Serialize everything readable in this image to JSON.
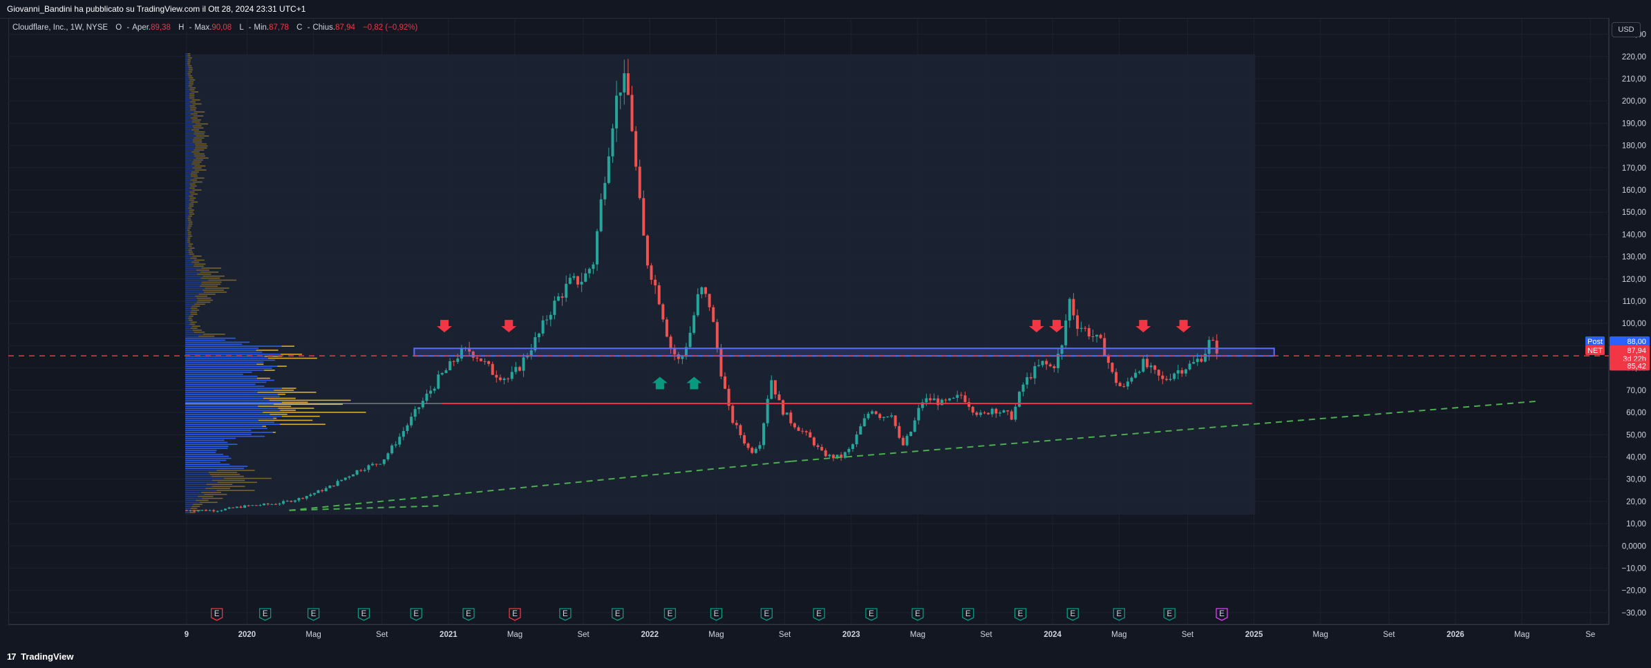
{
  "header": {
    "publish_line": "Giovanni_Bandini ha pubblicato su TradingView.com il Ott 28, 2024 23:31 UTC+1"
  },
  "legend": {
    "symbol": "Cloudflare, Inc., 1W, NYSE",
    "open_label": "O",
    "open_prefix": "Aper.",
    "open": "89,38",
    "high_label": "H",
    "high_prefix": "Max.",
    "high": "90,08",
    "low_label": "L",
    "low_prefix": "Min.",
    "low": "87,78",
    "close_label": "C",
    "close_prefix": "Chius.",
    "close": "87,94",
    "change": "−0,82 (−0,92%)"
  },
  "price_axis": {
    "currency_button": "USD",
    "post_tag": "Post",
    "post_value": "88,00",
    "symbol_tag": "NET",
    "last_value": "87,94",
    "countdown": "3d 22h",
    "line_value": "85,42"
  },
  "footer": {
    "brand": "TradingView",
    "brand_mark": "17"
  },
  "colors": {
    "background": "#131722",
    "up": "#26a69a",
    "down": "#ef5350",
    "resistance_box": "#5b6cff",
    "support_line": "#f23645",
    "trend_line": "#4caf50",
    "vp_blue": "#2962ff",
    "vp_yellow": "#e8b430",
    "arrow_down": "#f23645",
    "arrow_up": "#089981"
  },
  "chart_data": {
    "type": "candlestick",
    "price_ticks": [
      "230,00",
      "220,00",
      "210,00",
      "200,00",
      "190,00",
      "180,00",
      "170,00",
      "160,00",
      "150,00",
      "140,00",
      "130,00",
      "120,00",
      "110,00",
      "100,00",
      "90,00",
      "80,00",
      "70,00",
      "60,00",
      "50,00",
      "40,00",
      "30,00",
      "20,00",
      "10,00",
      "0,0000",
      "−10,00",
      "−20,00",
      "−30,00"
    ],
    "price_tick_values": [
      230,
      220,
      210,
      200,
      190,
      180,
      170,
      160,
      150,
      140,
      130,
      120,
      110,
      100,
      90,
      80,
      70,
      60,
      50,
      40,
      30,
      20,
      10,
      0,
      -10,
      -20,
      -30
    ],
    "ylim": [
      -35,
      237
    ],
    "time_ticks": [
      {
        "label": "9",
        "t": 2019.7
      },
      {
        "label": "2020",
        "t": 2020.0
      },
      {
        "label": "Mag",
        "t": 2020.33
      },
      {
        "label": "Set",
        "t": 2020.67
      },
      {
        "label": "2021",
        "t": 2021.0
      },
      {
        "label": "Mag",
        "t": 2021.33
      },
      {
        "label": "Set",
        "t": 2021.67
      },
      {
        "label": "2022",
        "t": 2022.0
      },
      {
        "label": "Mag",
        "t": 2022.33
      },
      {
        "label": "Set",
        "t": 2022.67
      },
      {
        "label": "2023",
        "t": 2023.0
      },
      {
        "label": "Mag",
        "t": 2023.33
      },
      {
        "label": "Set",
        "t": 2023.67
      },
      {
        "label": "2024",
        "t": 2024.0
      },
      {
        "label": "Mag",
        "t": 2024.33
      },
      {
        "label": "Set",
        "t": 2024.67
      },
      {
        "label": "2025",
        "t": 2025.0
      },
      {
        "label": "Mag",
        "t": 2025.33
      },
      {
        "label": "Set",
        "t": 2025.67
      },
      {
        "label": "2026",
        "t": 2026.0
      },
      {
        "label": "Mag",
        "t": 2026.33
      },
      {
        "label": "Se",
        "t": 2026.67
      }
    ],
    "xlim": [
      2019.7,
      2026.7
    ],
    "price_path": [
      [
        2019.7,
        16
      ],
      [
        2019.85,
        16
      ],
      [
        2020.0,
        18
      ],
      [
        2020.15,
        19
      ],
      [
        2020.25,
        21
      ],
      [
        2020.4,
        26
      ],
      [
        2020.55,
        34
      ],
      [
        2020.67,
        38
      ],
      [
        2020.75,
        48
      ],
      [
        2020.85,
        62
      ],
      [
        2020.95,
        75
      ],
      [
        2021.0,
        80
      ],
      [
        2021.05,
        86
      ],
      [
        2021.1,
        88
      ],
      [
        2021.15,
        85
      ],
      [
        2021.22,
        78
      ],
      [
        2021.3,
        75
      ],
      [
        2021.35,
        80
      ],
      [
        2021.4,
        88
      ],
      [
        2021.45,
        95
      ],
      [
        2021.5,
        105
      ],
      [
        2021.55,
        112
      ],
      [
        2021.6,
        118
      ],
      [
        2021.67,
        120
      ],
      [
        2021.72,
        128
      ],
      [
        2021.78,
        170
      ],
      [
        2021.82,
        195
      ],
      [
        2021.86,
        210
      ],
      [
        2021.9,
        200
      ],
      [
        2021.94,
        160
      ],
      [
        2021.98,
        130
      ],
      [
        2022.0,
        125
      ],
      [
        2022.05,
        110
      ],
      [
        2022.1,
        90
      ],
      [
        2022.15,
        82
      ],
      [
        2022.2,
        96
      ],
      [
        2022.25,
        116
      ],
      [
        2022.3,
        108
      ],
      [
        2022.35,
        80
      ],
      [
        2022.4,
        58
      ],
      [
        2022.45,
        50
      ],
      [
        2022.5,
        42
      ],
      [
        2022.55,
        47
      ],
      [
        2022.6,
        76
      ],
      [
        2022.65,
        62
      ],
      [
        2022.7,
        56
      ],
      [
        2022.75,
        52
      ],
      [
        2022.8,
        48
      ],
      [
        2022.85,
        42
      ],
      [
        2022.9,
        40
      ],
      [
        2022.95,
        40
      ],
      [
        2023.0,
        44
      ],
      [
        2023.05,
        54
      ],
      [
        2023.1,
        62
      ],
      [
        2023.15,
        58
      ],
      [
        2023.2,
        60
      ],
      [
        2023.25,
        44
      ],
      [
        2023.3,
        52
      ],
      [
        2023.35,
        65
      ],
      [
        2023.4,
        66
      ],
      [
        2023.45,
        64
      ],
      [
        2023.5,
        65
      ],
      [
        2023.55,
        68
      ],
      [
        2023.6,
        62
      ],
      [
        2023.65,
        58
      ],
      [
        2023.7,
        62
      ],
      [
        2023.75,
        60
      ],
      [
        2023.8,
        58
      ],
      [
        2023.85,
        72
      ],
      [
        2023.9,
        78
      ],
      [
        2023.95,
        82
      ],
      [
        2024.0,
        80
      ],
      [
        2024.05,
        90
      ],
      [
        2024.08,
        112
      ],
      [
        2024.12,
        100
      ],
      [
        2024.18,
        96
      ],
      [
        2024.25,
        90
      ],
      [
        2024.3,
        76
      ],
      [
        2024.35,
        70
      ],
      [
        2024.4,
        78
      ],
      [
        2024.45,
        82
      ],
      [
        2024.5,
        78
      ],
      [
        2024.55,
        74
      ],
      [
        2024.6,
        78
      ],
      [
        2024.65,
        80
      ],
      [
        2024.7,
        82
      ],
      [
        2024.75,
        86
      ],
      [
        2024.78,
        92
      ],
      [
        2024.82,
        88
      ]
    ],
    "volume_profile_poc": 64,
    "resistance_zone": {
      "low": 85.4,
      "high": 88.8,
      "t_start": 2020.83,
      "t_end": 2025.1
    },
    "support_line": {
      "value": 64,
      "t_start": 2020.97,
      "t_end": 2024.99
    },
    "last_price_line": 85.42,
    "trend_lines": [
      {
        "t1": 2020.21,
        "p1": 16,
        "t2": 2020.95,
        "p2": 18,
        "style": "dashed"
      },
      {
        "t1": 2020.21,
        "p1": 16,
        "t2": 2022.7,
        "p2": 38,
        "style": "dashed"
      },
      {
        "t1": 2022.7,
        "p1": 38,
        "t2": 2026.4,
        "p2": 65,
        "style": "dashed"
      }
    ],
    "down_arrows": [
      2020.98,
      2021.3,
      2023.92,
      2024.02,
      2024.45,
      2024.65
    ],
    "up_arrows": [
      2022.05,
      2022.22
    ],
    "events": [
      {
        "type": "dividend",
        "t": 2019.85,
        "label": "E"
      },
      {
        "type": "earnings",
        "t": 2020.09,
        "label": "E"
      },
      {
        "type": "earnings",
        "t": 2020.33,
        "label": "E"
      },
      {
        "type": "earnings",
        "t": 2020.58,
        "label": "E"
      },
      {
        "type": "earnings",
        "t": 2020.84,
        "label": "E"
      },
      {
        "type": "earnings",
        "t": 2021.1,
        "label": "E"
      },
      {
        "type": "dividend",
        "t": 2021.33,
        "label": "E"
      },
      {
        "type": "earnings",
        "t": 2021.58,
        "label": "E"
      },
      {
        "type": "earnings",
        "t": 2021.84,
        "label": "E"
      },
      {
        "type": "earnings",
        "t": 2022.1,
        "label": "E"
      },
      {
        "type": "earnings",
        "t": 2022.33,
        "label": "E"
      },
      {
        "type": "earnings",
        "t": 2022.58,
        "label": "E"
      },
      {
        "type": "earnings",
        "t": 2022.84,
        "label": "E"
      },
      {
        "type": "earnings",
        "t": 2023.1,
        "label": "E"
      },
      {
        "type": "earnings",
        "t": 2023.33,
        "label": "E"
      },
      {
        "type": "earnings",
        "t": 2023.58,
        "label": "E"
      },
      {
        "type": "earnings",
        "t": 2023.84,
        "label": "E"
      },
      {
        "type": "earnings",
        "t": 2024.1,
        "label": "E"
      },
      {
        "type": "earnings",
        "t": 2024.33,
        "label": "E"
      },
      {
        "type": "earnings",
        "t": 2024.58,
        "label": "E"
      },
      {
        "type": "upcoming",
        "t": 2024.84,
        "label": "E"
      }
    ]
  }
}
